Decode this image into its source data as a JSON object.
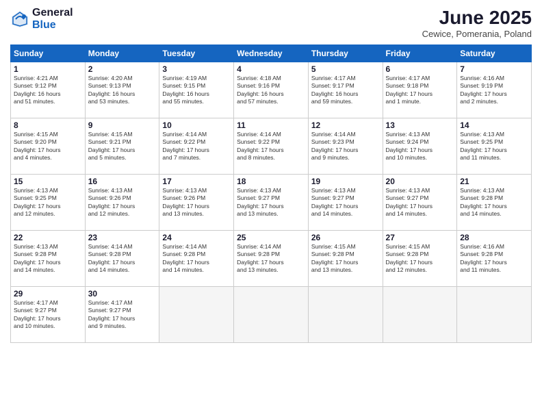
{
  "header": {
    "logo_line1": "General",
    "logo_line2": "Blue",
    "title": "June 2025",
    "subtitle": "Cewice, Pomerania, Poland"
  },
  "weekdays": [
    "Sunday",
    "Monday",
    "Tuesday",
    "Wednesday",
    "Thursday",
    "Friday",
    "Saturday"
  ],
  "weeks": [
    [
      {
        "day": "1",
        "info": "Sunrise: 4:21 AM\nSunset: 9:12 PM\nDaylight: 16 hours\nand 51 minutes."
      },
      {
        "day": "2",
        "info": "Sunrise: 4:20 AM\nSunset: 9:13 PM\nDaylight: 16 hours\nand 53 minutes."
      },
      {
        "day": "3",
        "info": "Sunrise: 4:19 AM\nSunset: 9:15 PM\nDaylight: 16 hours\nand 55 minutes."
      },
      {
        "day": "4",
        "info": "Sunrise: 4:18 AM\nSunset: 9:16 PM\nDaylight: 16 hours\nand 57 minutes."
      },
      {
        "day": "5",
        "info": "Sunrise: 4:17 AM\nSunset: 9:17 PM\nDaylight: 16 hours\nand 59 minutes."
      },
      {
        "day": "6",
        "info": "Sunrise: 4:17 AM\nSunset: 9:18 PM\nDaylight: 17 hours\nand 1 minute."
      },
      {
        "day": "7",
        "info": "Sunrise: 4:16 AM\nSunset: 9:19 PM\nDaylight: 17 hours\nand 2 minutes."
      }
    ],
    [
      {
        "day": "8",
        "info": "Sunrise: 4:15 AM\nSunset: 9:20 PM\nDaylight: 17 hours\nand 4 minutes."
      },
      {
        "day": "9",
        "info": "Sunrise: 4:15 AM\nSunset: 9:21 PM\nDaylight: 17 hours\nand 5 minutes."
      },
      {
        "day": "10",
        "info": "Sunrise: 4:14 AM\nSunset: 9:22 PM\nDaylight: 17 hours\nand 7 minutes."
      },
      {
        "day": "11",
        "info": "Sunrise: 4:14 AM\nSunset: 9:22 PM\nDaylight: 17 hours\nand 8 minutes."
      },
      {
        "day": "12",
        "info": "Sunrise: 4:14 AM\nSunset: 9:23 PM\nDaylight: 17 hours\nand 9 minutes."
      },
      {
        "day": "13",
        "info": "Sunrise: 4:13 AM\nSunset: 9:24 PM\nDaylight: 17 hours\nand 10 minutes."
      },
      {
        "day": "14",
        "info": "Sunrise: 4:13 AM\nSunset: 9:25 PM\nDaylight: 17 hours\nand 11 minutes."
      }
    ],
    [
      {
        "day": "15",
        "info": "Sunrise: 4:13 AM\nSunset: 9:25 PM\nDaylight: 17 hours\nand 12 minutes."
      },
      {
        "day": "16",
        "info": "Sunrise: 4:13 AM\nSunset: 9:26 PM\nDaylight: 17 hours\nand 12 minutes."
      },
      {
        "day": "17",
        "info": "Sunrise: 4:13 AM\nSunset: 9:26 PM\nDaylight: 17 hours\nand 13 minutes."
      },
      {
        "day": "18",
        "info": "Sunrise: 4:13 AM\nSunset: 9:27 PM\nDaylight: 17 hours\nand 13 minutes."
      },
      {
        "day": "19",
        "info": "Sunrise: 4:13 AM\nSunset: 9:27 PM\nDaylight: 17 hours\nand 14 minutes."
      },
      {
        "day": "20",
        "info": "Sunrise: 4:13 AM\nSunset: 9:27 PM\nDaylight: 17 hours\nand 14 minutes."
      },
      {
        "day": "21",
        "info": "Sunrise: 4:13 AM\nSunset: 9:28 PM\nDaylight: 17 hours\nand 14 minutes."
      }
    ],
    [
      {
        "day": "22",
        "info": "Sunrise: 4:13 AM\nSunset: 9:28 PM\nDaylight: 17 hours\nand 14 minutes."
      },
      {
        "day": "23",
        "info": "Sunrise: 4:14 AM\nSunset: 9:28 PM\nDaylight: 17 hours\nand 14 minutes."
      },
      {
        "day": "24",
        "info": "Sunrise: 4:14 AM\nSunset: 9:28 PM\nDaylight: 17 hours\nand 14 minutes."
      },
      {
        "day": "25",
        "info": "Sunrise: 4:14 AM\nSunset: 9:28 PM\nDaylight: 17 hours\nand 13 minutes."
      },
      {
        "day": "26",
        "info": "Sunrise: 4:15 AM\nSunset: 9:28 PM\nDaylight: 17 hours\nand 13 minutes."
      },
      {
        "day": "27",
        "info": "Sunrise: 4:15 AM\nSunset: 9:28 PM\nDaylight: 17 hours\nand 12 minutes."
      },
      {
        "day": "28",
        "info": "Sunrise: 4:16 AM\nSunset: 9:28 PM\nDaylight: 17 hours\nand 11 minutes."
      }
    ],
    [
      {
        "day": "29",
        "info": "Sunrise: 4:17 AM\nSunset: 9:27 PM\nDaylight: 17 hours\nand 10 minutes."
      },
      {
        "day": "30",
        "info": "Sunrise: 4:17 AM\nSunset: 9:27 PM\nDaylight: 17 hours\nand 9 minutes."
      },
      {
        "day": "",
        "info": ""
      },
      {
        "day": "",
        "info": ""
      },
      {
        "day": "",
        "info": ""
      },
      {
        "day": "",
        "info": ""
      },
      {
        "day": "",
        "info": ""
      }
    ]
  ]
}
